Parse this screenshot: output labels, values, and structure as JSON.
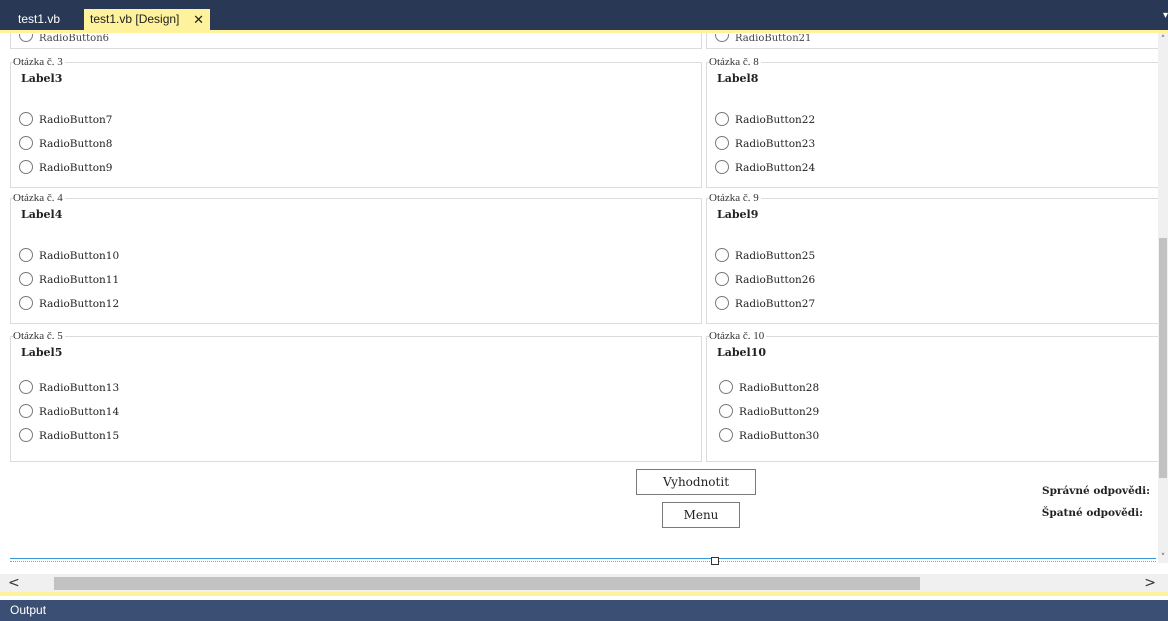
{
  "tabs": {
    "inactive": "test1.vb",
    "active": "test1.vb [Design]",
    "close_glyph": "✕",
    "dropdown_glyph": "▾"
  },
  "partial_top": {
    "left": "RadioButton6",
    "right": "RadioButton21"
  },
  "groups": [
    {
      "title": "Otázka č. 3",
      "label": "Label3",
      "radios": [
        "RadioButton7",
        "RadioButton8",
        "RadioButton9"
      ]
    },
    {
      "title": "Otázka č. 4",
      "label": "Label4",
      "radios": [
        "RadioButton10",
        "RadioButton11",
        "RadioButton12"
      ]
    },
    {
      "title": "Otázka č. 5",
      "label": "Label5",
      "radios": [
        "RadioButton13",
        "RadioButton14",
        "RadioButton15"
      ]
    },
    {
      "title": "Otázka č. 8",
      "label": "Label8",
      "radios": [
        "RadioButton22",
        "RadioButton23",
        "RadioButton24"
      ]
    },
    {
      "title": "Otázka č. 9",
      "label": "Label9",
      "radios": [
        "RadioButton25",
        "RadioButton26",
        "RadioButton27"
      ]
    },
    {
      "title": "Otázka č. 10",
      "label": "Label10",
      "radios": [
        "RadioButton28",
        "RadioButton29",
        "RadioButton30"
      ]
    }
  ],
  "buttons": {
    "evaluate": "Vyhodnotit",
    "menu": "Menu"
  },
  "stats": {
    "correct": "Správné odpovědi:",
    "wrong": "Špatné odpovědi:"
  },
  "scroll": {
    "left_arrow": "<",
    "right_arrow": ">",
    "up_arrow": "˄",
    "down_arrow": "˅"
  },
  "output_panel": {
    "title": "Output"
  },
  "colors": {
    "tabbar": "#293955",
    "active_tab": "#fff29d",
    "selection": "#3c98d6"
  }
}
